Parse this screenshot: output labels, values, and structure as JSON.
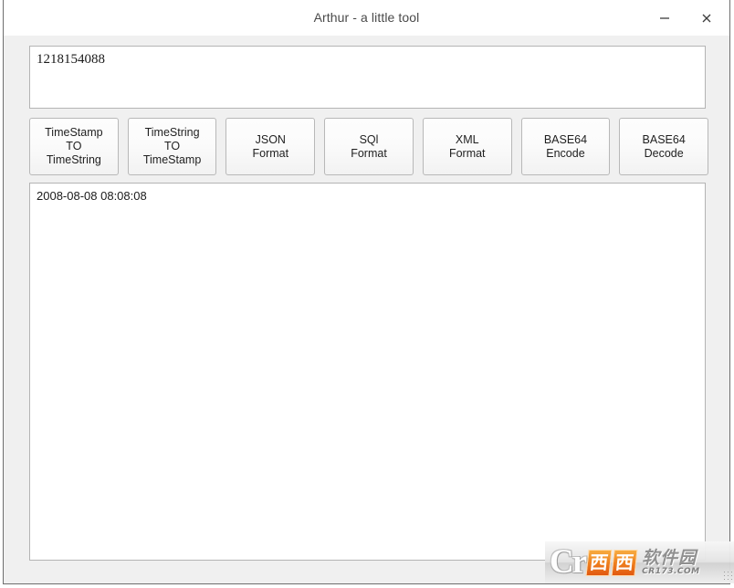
{
  "window": {
    "title": "Arthur - a little tool",
    "controls": {
      "minimize": "minimize-icon",
      "close": "close-icon"
    }
  },
  "input": {
    "value": "1218154088",
    "placeholder": ""
  },
  "buttons": [
    {
      "id": "timestamp-to-timestring",
      "lines": [
        "TimeStamp",
        "TO",
        "TimeString"
      ]
    },
    {
      "id": "timestring-to-timestamp",
      "lines": [
        "TimeString",
        "TO",
        "TimeStamp"
      ]
    },
    {
      "id": "json-format",
      "lines": [
        "JSON",
        "Format"
      ]
    },
    {
      "id": "sql-format",
      "lines": [
        "SQl",
        "Format"
      ]
    },
    {
      "id": "xml-format",
      "lines": [
        "XML",
        "Format"
      ]
    },
    {
      "id": "base64-encode",
      "lines": [
        "BASE64",
        "Encode"
      ]
    },
    {
      "id": "base64-decode",
      "lines": [
        "BASE64",
        "Decode"
      ]
    }
  ],
  "output": {
    "value": "2008-08-08 08:08:08"
  },
  "watermark": {
    "logo": "Cr",
    "cn_first": "西",
    "cn_second": "西",
    "cn_name": "软件园",
    "url": "CR173.COM"
  },
  "colors": {
    "window_bg": "#f0f0f0",
    "titlebar_bg": "#ffffff",
    "field_bg": "#ffffff",
    "field_border": "#b4b4b4",
    "button_border": "#b8b8b8",
    "text": "#1a1a1a",
    "title_text": "#4a4a4a",
    "watermark_orange": "#ef7d18",
    "watermark_gray": "#8d8d8d"
  }
}
